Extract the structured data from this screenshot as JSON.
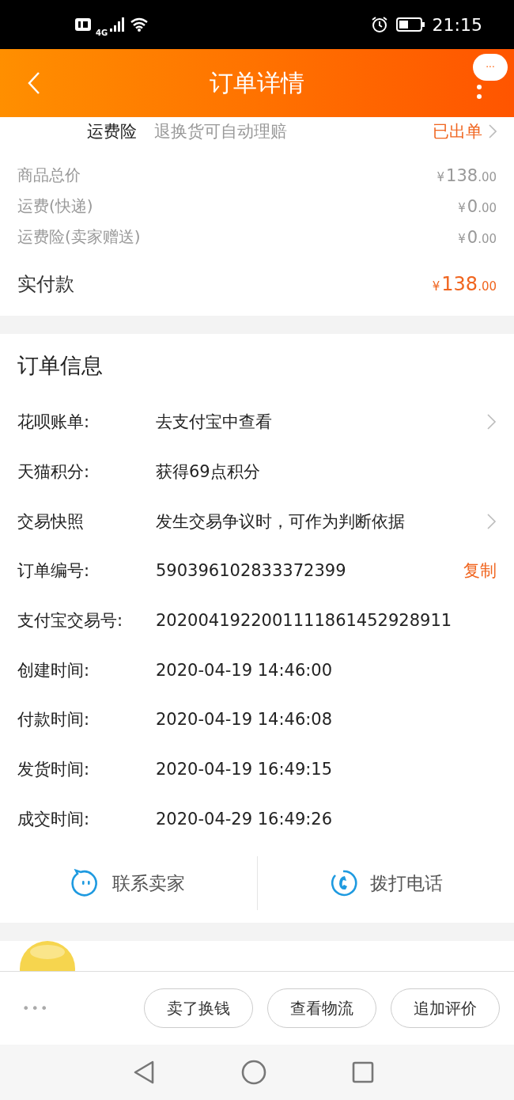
{
  "status_bar": {
    "network": "4G",
    "time": "21:15"
  },
  "nav": {
    "title": "订单详情",
    "more_badge": "···"
  },
  "insurance": {
    "label": "运费险",
    "description": "退换货可自动理赔",
    "status": "已出单"
  },
  "price_rows": [
    {
      "label": "商品总价",
      "currency": "¥",
      "amount": "138",
      "cents": ".00"
    },
    {
      "label": "运费(快递)",
      "currency": "¥",
      "amount": "0",
      "cents": ".00"
    },
    {
      "label": "运费险(卖家赠送)",
      "currency": "¥",
      "amount": "0",
      "cents": ".00"
    }
  ],
  "paid": {
    "label": "实付款",
    "currency": "¥",
    "amount": "138",
    "cents": ".00"
  },
  "order_info": {
    "title": "订单信息",
    "rows": [
      {
        "kind": "link",
        "label": "花呗账单:",
        "value": "去支付宝中查看"
      },
      {
        "kind": "plain",
        "label": "天猫积分:",
        "value": "获得69点积分"
      },
      {
        "kind": "link",
        "label": "交易快照",
        "value": "发生交易争议时，可作为判断依据"
      },
      {
        "kind": "copy",
        "label": "订单编号:",
        "value": "590396102833372399",
        "action": "复制"
      },
      {
        "kind": "plain",
        "label": "支付宝交易号:",
        "value": "2020041922001111861452928911"
      },
      {
        "kind": "plain",
        "label": "创建时间:",
        "value": "2020-04-19 14:46:00"
      },
      {
        "kind": "plain",
        "label": "付款时间:",
        "value": "2020-04-19 14:46:08"
      },
      {
        "kind": "plain",
        "label": "发货时间:",
        "value": "2020-04-19 16:49:15"
      },
      {
        "kind": "plain",
        "label": "成交时间:",
        "value": "2020-04-29 16:49:26"
      }
    ]
  },
  "contact": [
    {
      "kind": "chat",
      "label": "联系卖家"
    },
    {
      "kind": "phone",
      "label": "拨打电话"
    }
  ],
  "action_bar": {
    "more": "•••",
    "buttons": [
      "卖了换钱",
      "查看物流",
      "追加评价"
    ]
  }
}
